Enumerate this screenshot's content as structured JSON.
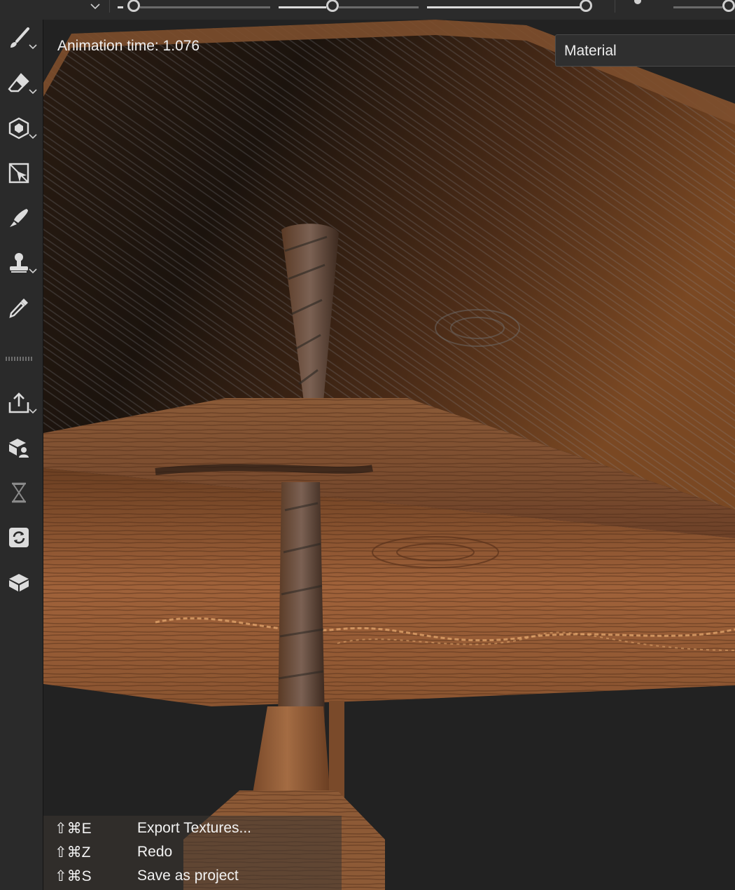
{
  "viewport": {
    "animation_time_label": "Animation time: 1.076",
    "material_select_value": "Material"
  },
  "shortcuts": [
    {
      "keys": "⇧⌘E",
      "label": "Export Textures..."
    },
    {
      "keys": "⇧⌘Z",
      "label": "Redo"
    },
    {
      "keys": "⇧⌘S",
      "label": "Save as project"
    }
  ],
  "toolbar_left": [
    {
      "icon": "paint-brush-icon"
    },
    {
      "icon": "eraser-icon"
    },
    {
      "icon": "projection-icon"
    },
    {
      "icon": "polygon-fill-icon"
    },
    {
      "icon": "smudge-icon"
    },
    {
      "icon": "clone-stamp-icon"
    },
    {
      "icon": "color-picker-icon"
    },
    {
      "icon": "export-icon"
    },
    {
      "icon": "bake-icon"
    },
    {
      "icon": "timeline-icon"
    },
    {
      "icon": "sync-icon"
    },
    {
      "icon": "mesh-icon"
    }
  ],
  "colors": {
    "ui_bg": "#2a2a2a",
    "viewport_bg": "#222222",
    "wood_light": "#b8743f",
    "wood_dark": "#1e140d"
  }
}
